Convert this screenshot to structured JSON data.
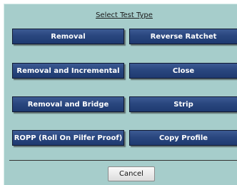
{
  "dialog": {
    "title": "Select Test Type",
    "buttons": {
      "removal": "Removal",
      "reverse_ratchet": "Reverse Ratchet",
      "removal_incremental": "Removal and Incremental",
      "close": "Close",
      "removal_bridge": "Removal and Bridge",
      "strip": "Strip",
      "ropp": "ROPP (Roll On Pilfer Proof)",
      "copy_profile": "Copy Profile"
    },
    "cancel": "Cancel"
  },
  "colors": {
    "background": "#a6cdcb",
    "button": "#2a477f",
    "button_text": "#ffffff"
  }
}
